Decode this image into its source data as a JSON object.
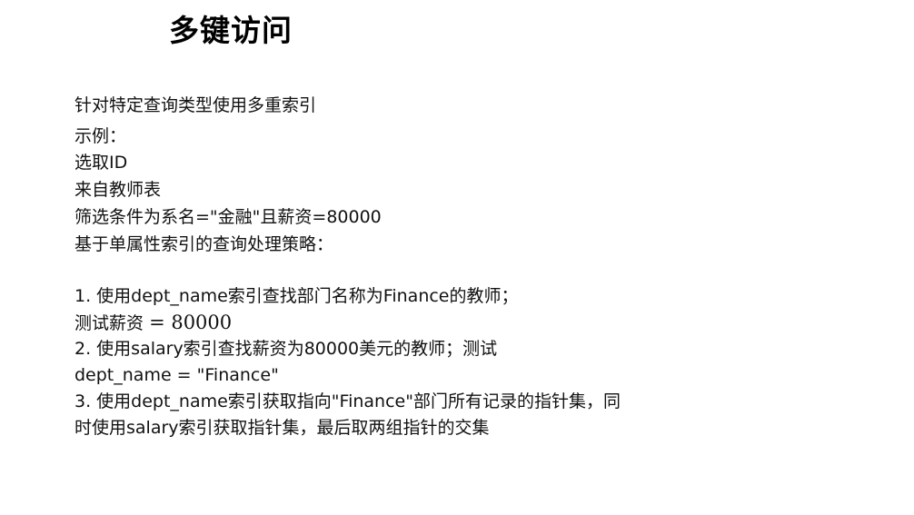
{
  "slide": {
    "title": "多键访问",
    "intro": "针对特定查询类型使用多重索引",
    "example": {
      "label": "示例：",
      "select": "选取ID",
      "from": "来自教师表",
      "where": "筛选条件为系名=\"金融\"且薪资=80000"
    },
    "strategy_heading": "基于单属性索引的查询处理策略：",
    "strategies": {
      "s1_line1": "1. 使用dept_name索引查找部门名称为Finance的教师；",
      "s1_line2_text": "测试薪资",
      "s1_line2_math": "= 80000",
      "s2_line1": "2. 使用salary索引查找薪资为80000美元的教师；测试",
      "s2_line2": "dept_name = \"Finance\"",
      "s3_line1": "3. 使用dept_name索引获取指向\"Finance\"部门所有记录的指针集，同",
      "s3_line2": "时使用salary索引获取指针集，最后取两组指针的交集"
    }
  }
}
